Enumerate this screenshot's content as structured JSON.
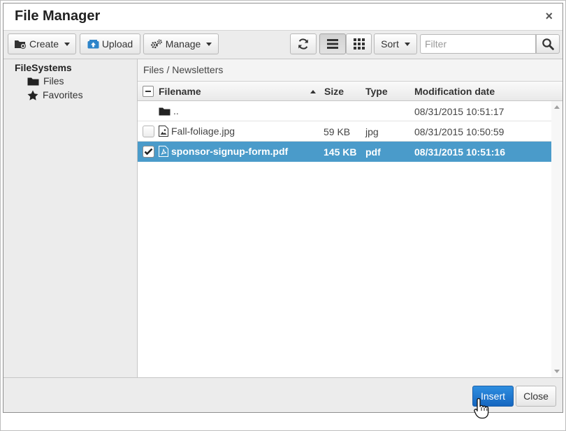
{
  "dialog": {
    "title": "File Manager",
    "close_glyph": "×"
  },
  "toolbar": {
    "create_label": "Create",
    "upload_label": "Upload",
    "manage_label": "Manage",
    "sort_label": "Sort",
    "filter_placeholder": "Filter",
    "filter_value": ""
  },
  "sidebar": {
    "root_label": "FileSystems",
    "items": [
      {
        "label": "Files",
        "icon": "folder-icon"
      },
      {
        "label": "Favorites",
        "icon": "star-icon"
      }
    ]
  },
  "breadcrumb": "Files / Newsletters",
  "grid": {
    "columns": {
      "filename": "Filename",
      "size": "Size",
      "type": "Type",
      "modified": "Modification date"
    },
    "rows": [
      {
        "name": "..",
        "icon": "folder-icon",
        "size": "",
        "type": "",
        "modified": "08/31/2015 10:51:17",
        "checked": false,
        "selected": false,
        "has_checkbox": false
      },
      {
        "name": "Fall-foliage.jpg",
        "icon": "image-file-icon",
        "size": "59 KB",
        "type": "jpg",
        "modified": "08/31/2015 10:50:59",
        "checked": false,
        "selected": false,
        "has_checkbox": true
      },
      {
        "name": "sponsor-signup-form.pdf",
        "icon": "pdf-file-icon",
        "size": "145 KB",
        "type": "pdf",
        "modified": "08/31/2015 10:51:16",
        "checked": true,
        "selected": true,
        "has_checkbox": true
      }
    ]
  },
  "footer": {
    "insert_label": "Insert",
    "close_label": "Close"
  },
  "colors": {
    "selection": "#4a9bca",
    "primary_button": "#1566c0"
  }
}
